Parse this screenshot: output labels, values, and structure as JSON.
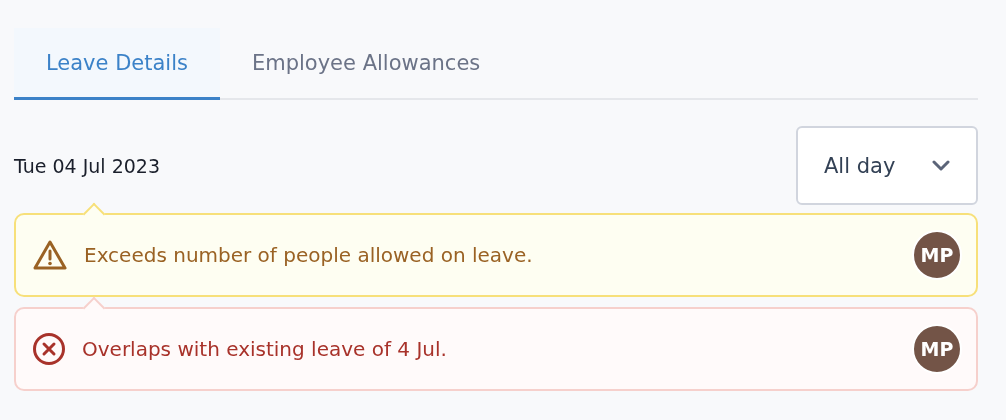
{
  "tabs": [
    {
      "label": "Leave Details",
      "selected": true
    },
    {
      "label": "Employee Allowances",
      "selected": false
    }
  ],
  "date": "Tue 04 Jul 2023",
  "duration_select": {
    "value": "All day"
  },
  "alerts": [
    {
      "kind": "warning",
      "message": "Exceeds number of people allowed on leave.",
      "avatar": "MP"
    },
    {
      "kind": "error",
      "message": "Overlaps with existing leave of 4 Jul.",
      "avatar": "MP"
    }
  ]
}
